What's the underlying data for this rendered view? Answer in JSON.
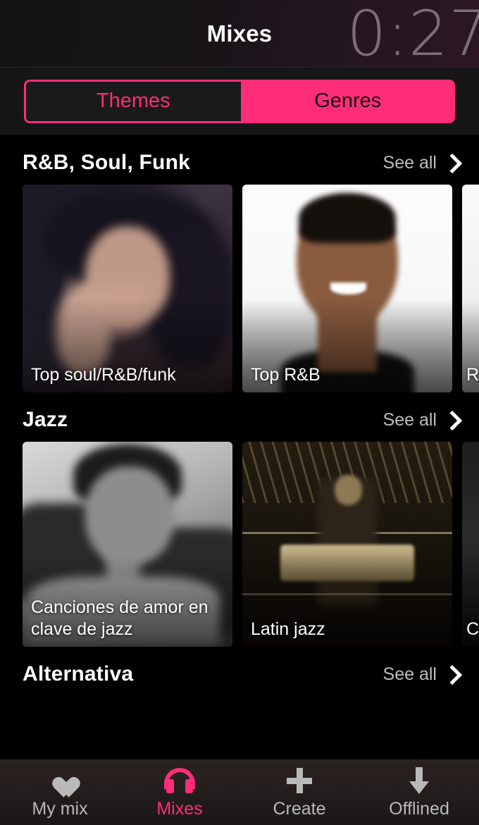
{
  "header": {
    "title": "Mixes",
    "timer": "0:27"
  },
  "tabs": {
    "themes_label": "Themes",
    "genres_label": "Genres",
    "selected": "Genres"
  },
  "see_all_label": "See all",
  "sections": [
    {
      "title": "R&B, Soul, Funk",
      "cards": [
        {
          "label": "Top soul/R&B/funk"
        },
        {
          "label": "Top R&B"
        },
        {
          "label": "R"
        }
      ]
    },
    {
      "title": "Jazz",
      "cards": [
        {
          "label": "Canciones de amor en clave de jazz"
        },
        {
          "label": "Latin jazz"
        },
        {
          "label": "C"
        }
      ]
    },
    {
      "title": "Alternativa",
      "cards": []
    }
  ],
  "bottom_nav": {
    "items": [
      {
        "label": "My mix",
        "icon": "heart-icon",
        "active": false
      },
      {
        "label": "Mixes",
        "icon": "headphones-icon",
        "active": true
      },
      {
        "label": "Create",
        "icon": "plus-icon",
        "active": false
      },
      {
        "label": "Offlined",
        "icon": "download-arrow-icon",
        "active": false
      }
    ]
  },
  "colors": {
    "accent_pink": "#ff2d78",
    "background": "#000000",
    "header_bg": "#161616",
    "muted_text": "#b9b9b9"
  }
}
